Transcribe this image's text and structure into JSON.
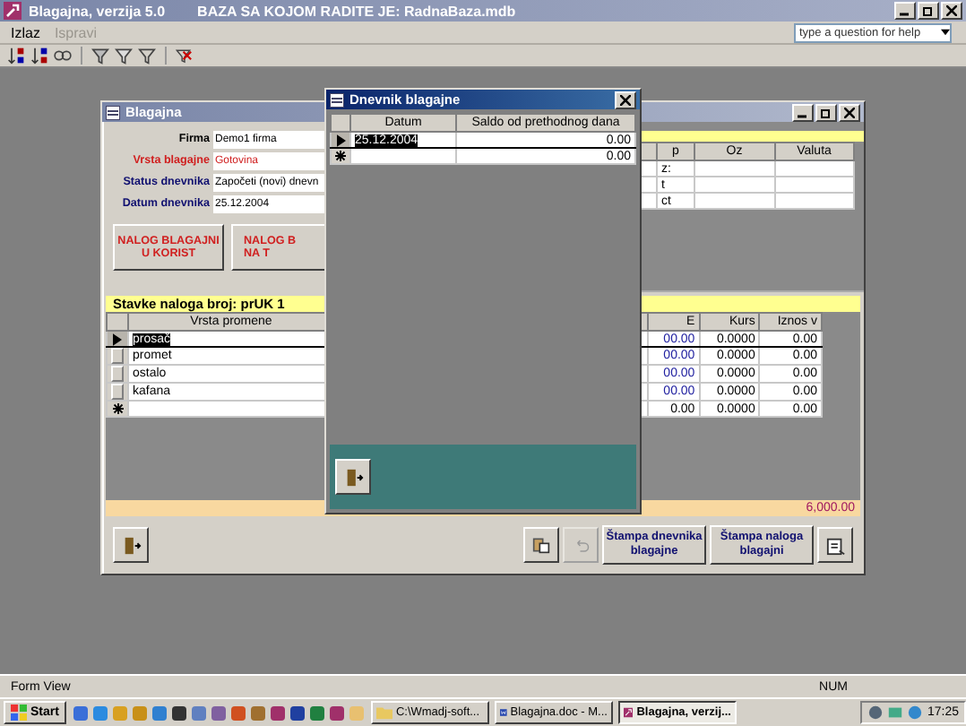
{
  "app": {
    "title": "Blagajna, verzija 5.0",
    "database_note": "BAZA SA KOJOM RADITE JE: RadnaBaza.mdb"
  },
  "menu": [
    {
      "label": "Izlaz",
      "disabled": false
    },
    {
      "label": "Ispravi",
      "disabled": true
    }
  ],
  "help_box": {
    "placeholder": "type a question for help"
  },
  "blagajna_window": {
    "title": "Blagajna",
    "fields": [
      {
        "label": "Firma",
        "value": "Demo1 firma",
        "kind": "normal"
      },
      {
        "label": "Vrsta blagajne",
        "value": "Gotovina",
        "kind": "required"
      },
      {
        "label": "Status dnevnika",
        "value": "Započeti (novi) dnevn",
        "kind": "info"
      },
      {
        "label": "Datum dnevnika",
        "value": "25.12.2004",
        "kind": "info"
      }
    ],
    "order_buttons": [
      {
        "lines": [
          "NALOG BLAGAJNI",
          "U KORIST"
        ]
      },
      {
        "lines": [
          "NALOG B",
          "NA T"
        ]
      }
    ],
    "accounts_table": {
      "columns": [
        "p",
        "Oz",
        "Valuta"
      ],
      "rows": [
        [
          "z:",
          "",
          ""
        ],
        [
          "t",
          "",
          ""
        ],
        [
          "ct",
          "",
          ""
        ]
      ]
    },
    "items": {
      "heading": "Stavke naloga broj: prUK 1",
      "columns": [
        "Vrsta promene",
        "E",
        "Kurs",
        "Iznos v"
      ],
      "rows": [
        {
          "kind": "current",
          "selected": true,
          "cells": [
            "prosač",
            "00.00",
            "0.0000",
            "0.00"
          ]
        },
        {
          "kind": "record",
          "selected": false,
          "cells": [
            "promet",
            "00.00",
            "0.0000",
            "0.00"
          ]
        },
        {
          "kind": "record",
          "selected": false,
          "cells": [
            "ostalo",
            "00.00",
            "0.0000",
            "0.00"
          ]
        },
        {
          "kind": "record",
          "selected": false,
          "cells": [
            "kafana",
            "00.00",
            "0.0000",
            "0.00"
          ]
        },
        {
          "kind": "new",
          "selected": false,
          "cells": [
            "",
            "0.00",
            "0.0000",
            "0.00"
          ]
        }
      ]
    },
    "total": "6,000.00",
    "bottom_buttons": [
      {
        "kind": "exit",
        "disabled": false
      },
      {
        "kind": "paste",
        "disabled": false
      },
      {
        "kind": "undo",
        "disabled": true
      },
      {
        "kind": "text",
        "label": "Štampa dnevnika blagajne",
        "disabled": false
      },
      {
        "kind": "text",
        "label": "Štampa naloga blagajni",
        "disabled": false
      },
      {
        "kind": "report",
        "disabled": false
      }
    ]
  },
  "dnevnik_window": {
    "title": "Dnevnik blagajne",
    "columns": [
      "Datum",
      "Saldo od prethodnog dana"
    ],
    "rows": [
      {
        "kind": "current",
        "selected": true,
        "cells": [
          "25.12.2004",
          "0.00"
        ]
      },
      {
        "kind": "new",
        "selected": false,
        "cells": [
          "",
          "0.00"
        ]
      }
    ]
  },
  "status_bar": {
    "mode": "Form View",
    "indicator": "NUM"
  },
  "taskbar": {
    "start": "Start",
    "tasks": [
      {
        "kind": "folder",
        "label": "C:\\Wmadj-soft...",
        "selected": false
      },
      {
        "kind": "word",
        "label": "Blagajna.doc - M...",
        "selected": false
      },
      {
        "kind": "access",
        "label": "Blagajna, verzij...",
        "selected": true
      }
    ],
    "clock": "17:25"
  }
}
